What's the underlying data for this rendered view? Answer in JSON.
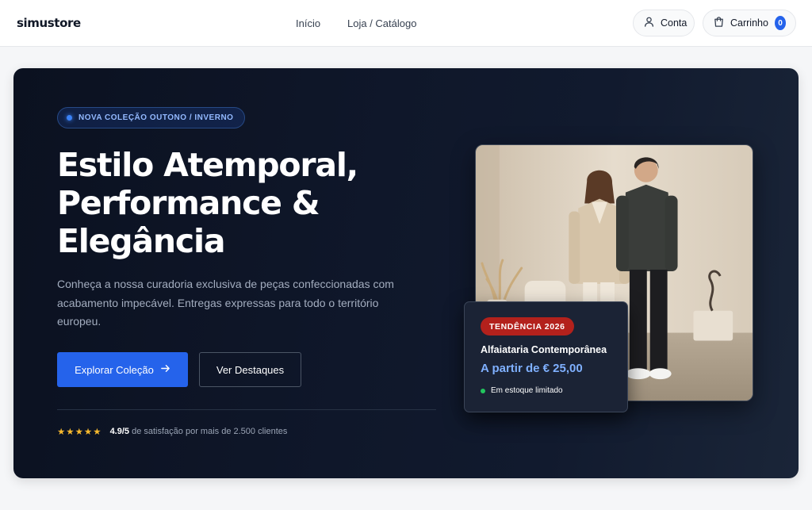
{
  "header": {
    "logo": "simustore",
    "nav": [
      {
        "label": "Início"
      },
      {
        "label": "Loja / Catálogo"
      }
    ],
    "account_label": "Conta",
    "cart_label": "Carrinho",
    "cart_count": "0"
  },
  "hero": {
    "badge": "NOVA COLEÇÃO OUTONO / INVERNO",
    "headline": [
      "Estilo Atemporal,",
      "Performance &",
      "Elegância"
    ],
    "description": "Conheça a nossa curadoria exclusiva de peças confeccionadas com acabamento impecável. Entregas expressas para todo o território europeu.",
    "primary_button": "Explorar Coleção",
    "secondary_button": "Ver Destaques",
    "rating": {
      "stars": "★★★★★",
      "score": "4.9/5",
      "text": "de satisfação por mais de 2.500 clientes"
    }
  },
  "product_card": {
    "tag": "TENDÊNCIA 2026",
    "title": "Alfaiataria Contemporânea",
    "price": "A partir de € 25,00",
    "stock": "Em estoque limitado"
  },
  "colors": {
    "accent": "#2563eb",
    "hero_bg": "#0f172a",
    "trend_tag": "#b3211c",
    "price": "#7fb0ff",
    "stars": "#f5b82e",
    "stock_dot": "#22c55e"
  },
  "icons": {
    "account": "user-icon",
    "cart": "shopping-bag-icon",
    "arrow": "arrow-right-icon"
  }
}
